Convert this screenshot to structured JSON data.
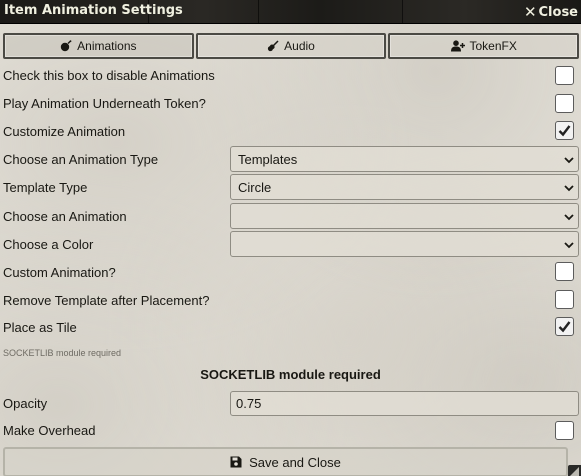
{
  "window": {
    "title": "Item Animation Settings",
    "close_label": "Close"
  },
  "tabs": [
    {
      "label": "Animations",
      "icon": "bomb-icon",
      "active": true
    },
    {
      "label": "Audio",
      "icon": "guitar-icon",
      "active": false
    },
    {
      "label": "TokenFX",
      "icon": "user-plus-icon",
      "active": false
    }
  ],
  "fields": {
    "disable_animations": {
      "label": "Check this box to disable Animations",
      "checked": false
    },
    "below_token": {
      "label": "Play Animation Underneath Token?",
      "checked": false
    },
    "customize": {
      "label": "Customize Animation",
      "checked": true
    },
    "animation_type": {
      "label": "Choose an Animation Type",
      "value": "Templates"
    },
    "template_type": {
      "label": "Template Type",
      "value": "Circle"
    },
    "animation": {
      "label": "Choose an Animation",
      "value": ""
    },
    "color": {
      "label": "Choose a Color",
      "value": ""
    },
    "custom_animation": {
      "label": "Custom Animation?",
      "checked": false
    },
    "remove_template": {
      "label": "Remove Template after Placement?",
      "checked": false
    },
    "place_as_tile": {
      "label": "Place as Tile",
      "checked": true
    },
    "opacity": {
      "label": "Opacity",
      "value": "0.75"
    },
    "make_overhead": {
      "label": "Make Overhead",
      "checked": false
    }
  },
  "hint": "SOCKETLIB module required",
  "notice": "SOCKETLIB module required",
  "save_label": "Save and Close",
  "colors": {
    "titlebar": "#191918",
    "title_text": "#f0f0e0",
    "panel": "#e4e1d9",
    "tab_border": "#4b4a44"
  }
}
